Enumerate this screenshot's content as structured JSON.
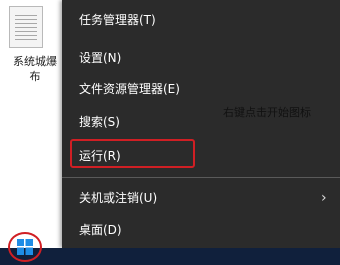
{
  "desktop": {
    "file_label_line1": "系统城爆",
    "file_label_line2": "布"
  },
  "menu": {
    "items": [
      {
        "label": "任务管理器(T)"
      },
      {
        "label": "设置(N)"
      },
      {
        "label": "文件资源管理器(E)"
      },
      {
        "label": "搜索(S)"
      },
      {
        "label": "运行(R)"
      },
      {
        "label": "关机或注销(U)"
      },
      {
        "label": "桌面(D)"
      }
    ],
    "submenu_arrow": "›"
  },
  "annotation": {
    "text": "右键点击开始图标"
  },
  "colors": {
    "menu_bg": "#2b2b2b",
    "highlight": "#d01f24",
    "taskbar": "#10203c",
    "windows_logo": "#1e8de6"
  },
  "icons": {
    "start": "windows-logo-icon",
    "file": "document-icon",
    "submenu": "chevron-right-icon"
  }
}
